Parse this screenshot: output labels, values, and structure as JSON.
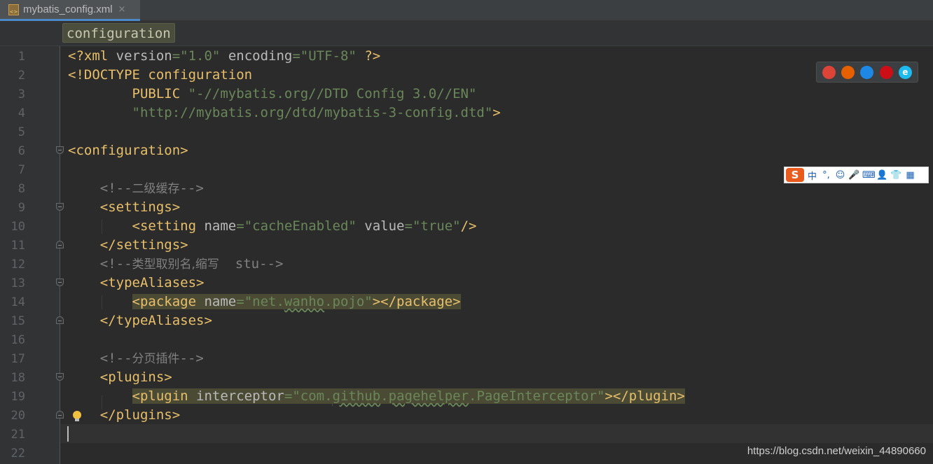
{
  "tab": {
    "file_name": "mybatis_config.xml",
    "close": "×",
    "icon_label": "<>"
  },
  "breadcrumb": {
    "label": "configuration"
  },
  "line_numbers": [
    "1",
    "2",
    "3",
    "4",
    "5",
    "6",
    "7",
    "8",
    "9",
    "10",
    "11",
    "12",
    "13",
    "14",
    "15",
    "16",
    "17",
    "18",
    "19",
    "20",
    "21",
    "22"
  ],
  "code": {
    "l1_a": "<?xml ",
    "l1_b": "version",
    "l1_c": "=",
    "l1_d": "\"1.0\"",
    "l1_e": " ",
    "l1_f": "encoding",
    "l1_g": "=",
    "l1_h": "\"UTF-8\"",
    "l1_i": " ?>",
    "l2": "<!DOCTYPE configuration",
    "l3_a": "        PUBLIC ",
    "l3_b": "\"-//mybatis.org//DTD Config 3.0//EN\"",
    "l4_a": "        ",
    "l4_b": "\"http://mybatis.org/dtd/mybatis-3-config.dtd\"",
    "l4_c": ">",
    "l6": "<configuration>",
    "l8_a": "    <!--",
    "l8_b": "二级缓存",
    "l8_c": "-->",
    "l9": "    <settings>",
    "l10_a": "        <setting ",
    "l10_b": "name",
    "l10_c": "=",
    "l10_d": "\"cacheEnabled\"",
    "l10_e": " ",
    "l10_f": "value",
    "l10_g": "=",
    "l10_h": "\"true\"",
    "l10_i": "/>",
    "l11": "    </settings>",
    "l12_a": "    <!--",
    "l12_b": "类型取别名,缩写",
    "l12_c": "  stu-->",
    "l13": "    <typeAliases>",
    "l14_indent": "        ",
    "l14_a": "<package ",
    "l14_b": "name",
    "l14_c": "=",
    "l14_d": "\"net.",
    "l14_e": "wanho",
    "l14_f": ".pojo\"",
    "l14_g": "></package>",
    "l15": "    </typeAliases>",
    "l17_a": "    <!--",
    "l17_b": "分页插件",
    "l17_c": "-->",
    "l18": "    <plugins>",
    "l19_indent": "        ",
    "l19_a": "<plugin ",
    "l19_b": "interceptor",
    "l19_c": "=",
    "l19_d": "\"com.",
    "l19_e": "github",
    "l19_f": ".",
    "l19_g": "pagehelper",
    "l19_h": ".PageInterceptor\"",
    "l19_i": "></plugin>",
    "l20": "    </plugins>"
  },
  "browsers": [
    {
      "name": "chrome",
      "color": "#db4437"
    },
    {
      "name": "firefox",
      "color": "#e66000"
    },
    {
      "name": "safari",
      "color": "#1e88e5"
    },
    {
      "name": "opera",
      "color": "#cc0f16"
    },
    {
      "name": "ie",
      "color": "#1ebbee",
      "glyph": "e"
    }
  ],
  "ime": {
    "logo": "S",
    "items": [
      "中",
      "°,",
      "☺",
      "🎤",
      "⌨",
      "👤",
      "👕",
      "▦"
    ]
  },
  "watermark": "https://blog.csdn.net/weixin_44890660"
}
